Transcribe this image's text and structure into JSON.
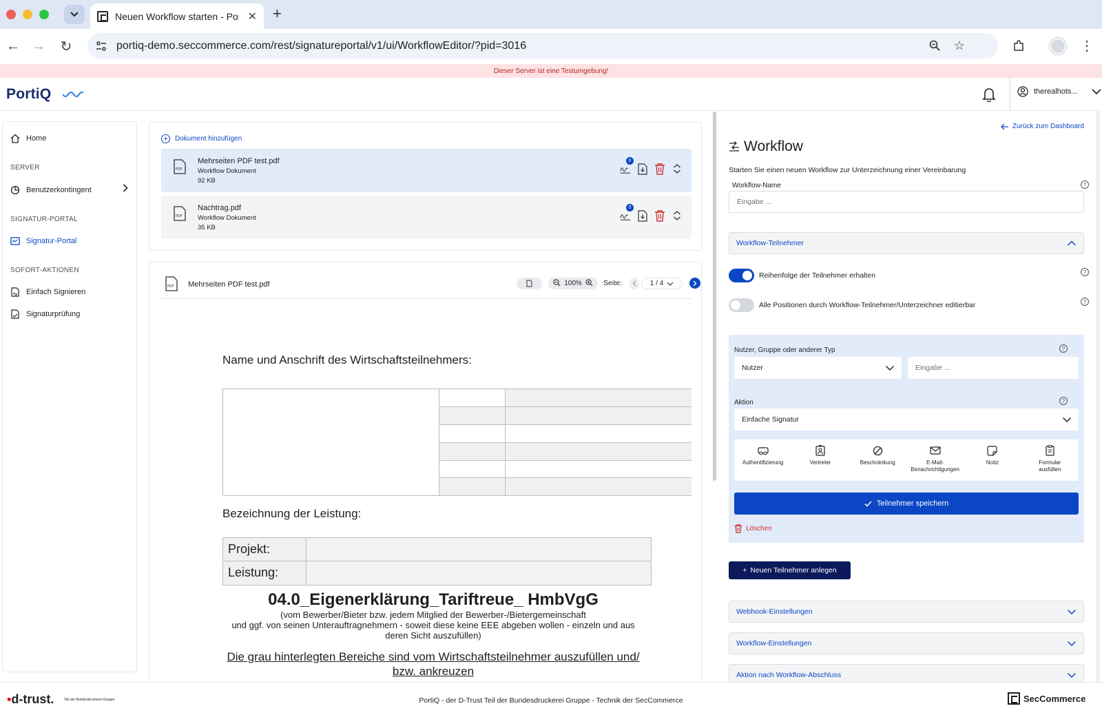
{
  "browser": {
    "tab_title": "Neuen Workflow starten - PortiQ",
    "url": "portiq-demo.seccommerce.com/rest/signatureportal/v1/ui/WorkflowEditor/?pid=3016"
  },
  "banner": {
    "text": "Dieser Server ist eine Testumgebung!"
  },
  "header": {
    "logo_text": "PortiQ",
    "username": "therealhots..."
  },
  "sidebar": {
    "home": "Home",
    "section_server": "SERVER",
    "benutzerkontingent": "Benutzerkontingent",
    "section_portal": "SIGNATUR-PORTAL",
    "signatur_portal": "Signatur-Portal",
    "section_sofort": "SOFORT-AKTIONEN",
    "einfach_signieren": "Einfach Signieren",
    "signaturpruefung": "Signaturprüfung"
  },
  "documents": {
    "add_label": "Dokument hinzufügen",
    "items": [
      {
        "name": "Mehrseiten PDF test.pdf",
        "type": "Workflow Dokument",
        "size": "92 KB",
        "signature_count": "0"
      },
      {
        "name": "Nachtrag.pdf",
        "type": "Workflow Dokument",
        "size": "35 KB",
        "signature_count": "0"
      }
    ]
  },
  "viewer": {
    "file_name": "Mehrseiten PDF test.pdf",
    "zoom": "100%",
    "page_label": "Seite:",
    "page_value": "1 / 4"
  },
  "pdf_page": {
    "heading1": "Name und Anschrift des Wirtschaftsteilnehmers:",
    "heading2": "Bezeichnung der Leistung:",
    "row1_label": "Projekt:",
    "row2_label": "Leistung:",
    "title": "04.0_Eigenerklärung_Tariftreue_ HmbVgG",
    "sub_line1": "(vom Bewerber/Bieter bzw. jedem Mitglied der Bewerber-/Bietergemeinschaft",
    "sub_line2": "und ggf. von seinen Unterauftragnehmern - soweit diese keine EEE abgeben wollen - einzeln und aus",
    "sub_line3": "deren Sicht auszufüllen)",
    "underlined": "Die grau hinterlegten Bereiche sind vom Wirtschaftsteilnehmer auszufüllen und/",
    "underlined_cut": "bzw. ankreuzen"
  },
  "workflow": {
    "back_link": "Zurück zum Dashboard",
    "title": "Workflow",
    "description": "Starten Sie einen neuen Workflow zur Unterzeichnung einer Vereinbarung",
    "name_label": "Workflow-Name",
    "name_placeholder": "Eingabe ...",
    "participants_header": "Workflow-Teilnehmer",
    "toggle_order_label": "Reihenfolge der Teilnehmer erhalten",
    "toggle_order_on": true,
    "toggle_edit_label": "Alle Positionen durch Workflow-Teilnehmer/Unterzeichner editierbar",
    "toggle_edit_on": false,
    "participant": {
      "type_label": "Nutzer, Gruppe oder anderer Typ",
      "type_value": "Nutzer",
      "input_placeholder": "Eingabe ...",
      "action_label": "Aktion",
      "action_value": "Einfache Signatur",
      "options": [
        {
          "icon": "authentication-icon",
          "label": "Authentifizierung"
        },
        {
          "icon": "representative-icon",
          "label": "Vertreter"
        },
        {
          "icon": "restriction-icon",
          "label": "Beschränkung"
        },
        {
          "icon": "email-icon",
          "label": "E-Mail-Benachrichtigungen"
        },
        {
          "icon": "note-icon",
          "label": "Notiz"
        },
        {
          "icon": "form-icon",
          "label": "Formular ausfüllen"
        }
      ],
      "save_label": "Teilnehmer speichern",
      "delete_label": "Löschen"
    },
    "new_participant_label": "Neuen Teilnehmer anlegen",
    "webhook_header": "Webhook-Einstellungen",
    "settings_header": "Workflow-Einstellungen",
    "after_header": "Aktion nach Workflow-Abschluss"
  },
  "footer": {
    "brand_left": "d-trust.",
    "brand_left_sub": "Teil der Bundesdruckerei-Gruppe",
    "center": "PortiQ - der D-Trust Teil der Bundesdruckerei Gruppe - Technik der SecCommerce",
    "brand_right": "SecCommerce"
  },
  "colors": {
    "accent": "#0b47c4",
    "navy": "#0c1a5c",
    "danger": "#d0302f",
    "banner_bg": "#fde2e4",
    "participant_card_bg": "#e2ebfa"
  }
}
